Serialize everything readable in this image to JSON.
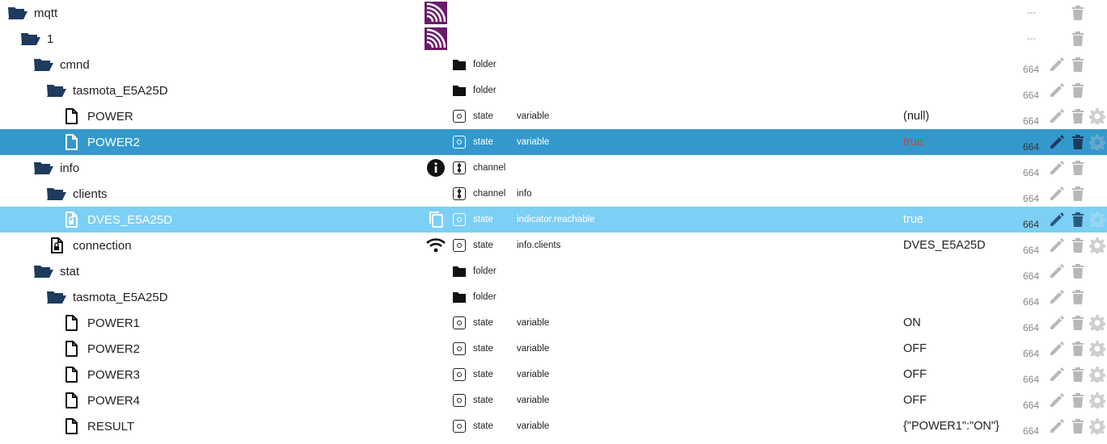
{
  "rows": [
    {
      "name": "mqtt",
      "depth": 0,
      "icon": "folder-open-icon",
      "acl": "---",
      "cmark": "adapter-logo",
      "type": "",
      "role": "",
      "value": "",
      "actions": [
        "del"
      ]
    },
    {
      "name": "1",
      "depth": 1,
      "icon": "folder-open-icon",
      "acl": "---",
      "cmark": "adapter-logo",
      "type": "",
      "role": "",
      "value": "",
      "actions": [
        "del"
      ]
    },
    {
      "name": "cmnd",
      "depth": 2,
      "icon": "folder-open-icon",
      "acl": "664",
      "type": "folder",
      "typeIcon": "folder",
      "role": "",
      "value": "",
      "actions": [
        "edit",
        "del"
      ]
    },
    {
      "name": "tasmota_E5A25D",
      "depth": 3,
      "icon": "folder-open-icon",
      "acl": "664",
      "type": "folder",
      "typeIcon": "folder",
      "role": "",
      "value": "",
      "actions": [
        "edit",
        "del"
      ]
    },
    {
      "name": "POWER",
      "depth": 4,
      "icon": "file-icon",
      "acl": "664",
      "type": "state",
      "typeIcon": "state",
      "role": "variable",
      "value": "(null)",
      "actions": [
        "edit",
        "del",
        "cfg"
      ]
    },
    {
      "name": "POWER2",
      "depth": 4,
      "icon": "file-icon",
      "acl": "664",
      "type": "state",
      "typeIcon": "state",
      "role": "variable",
      "value": "true",
      "valueRed": true,
      "state": "selected",
      "actions": [
        "edit",
        "del",
        "cfg"
      ]
    },
    {
      "name": "info",
      "depth": 2,
      "icon": "folder-open-icon",
      "acl": "664",
      "cmark": "info-icon",
      "type": "channel",
      "typeIcon": "channel",
      "role": "",
      "value": "",
      "actions": [
        "edit",
        "del"
      ]
    },
    {
      "name": "clients",
      "depth": 3,
      "icon": "folder-open-icon",
      "acl": "664",
      "type": "channel",
      "typeIcon": "channel",
      "role": "info",
      "value": "",
      "actions": [
        "edit",
        "del"
      ]
    },
    {
      "name": "DVES_E5A25D",
      "depth": 4,
      "icon": "file-lock-icon",
      "acl": "664",
      "cmark": "copy-icon",
      "type": "state",
      "typeIcon": "state",
      "role": "indicator.reachable",
      "value": "true",
      "state": "hover",
      "actions": [
        "edit",
        "del",
        "cfg"
      ]
    },
    {
      "name": "connection",
      "depth": 3,
      "icon": "file-lock-icon",
      "acl": "664",
      "cmark": "wifi-icon",
      "type": "state",
      "typeIcon": "state",
      "role": "info.clients",
      "value": "DVES_E5A25D",
      "actions": [
        "edit",
        "del",
        "cfg"
      ]
    },
    {
      "name": "stat",
      "depth": 2,
      "icon": "folder-open-icon",
      "acl": "664",
      "type": "folder",
      "typeIcon": "folder",
      "role": "",
      "value": "",
      "actions": [
        "edit",
        "del"
      ]
    },
    {
      "name": "tasmota_E5A25D",
      "depth": 3,
      "icon": "folder-open-icon",
      "acl": "664",
      "type": "folder",
      "typeIcon": "folder",
      "role": "",
      "value": "",
      "actions": [
        "edit",
        "del"
      ]
    },
    {
      "name": "POWER1",
      "depth": 4,
      "icon": "file-icon",
      "acl": "664",
      "type": "state",
      "typeIcon": "state",
      "role": "variable",
      "value": "ON",
      "actions": [
        "edit",
        "del",
        "cfg"
      ]
    },
    {
      "name": "POWER2",
      "depth": 4,
      "icon": "file-icon",
      "acl": "664",
      "type": "state",
      "typeIcon": "state",
      "role": "variable",
      "value": "OFF",
      "actions": [
        "edit",
        "del",
        "cfg"
      ]
    },
    {
      "name": "POWER3",
      "depth": 4,
      "icon": "file-icon",
      "acl": "664",
      "type": "state",
      "typeIcon": "state",
      "role": "variable",
      "value": "OFF",
      "actions": [
        "edit",
        "del",
        "cfg"
      ]
    },
    {
      "name": "POWER4",
      "depth": 4,
      "icon": "file-icon",
      "acl": "664",
      "type": "state",
      "typeIcon": "state",
      "role": "variable",
      "value": "OFF",
      "actions": [
        "edit",
        "del",
        "cfg"
      ]
    },
    {
      "name": "RESULT",
      "depth": 4,
      "icon": "file-icon",
      "acl": "664",
      "type": "state",
      "typeIcon": "state",
      "role": "variable",
      "value": "{\"POWER1\":\"ON\"}",
      "actions": [
        "edit",
        "del",
        "cfg"
      ]
    }
  ],
  "colors": {
    "folder": "#1e3a5f",
    "selected": "#3399cc",
    "hover": "#7ccff5",
    "logo": "#6a1b6a",
    "red": "#e53935"
  }
}
